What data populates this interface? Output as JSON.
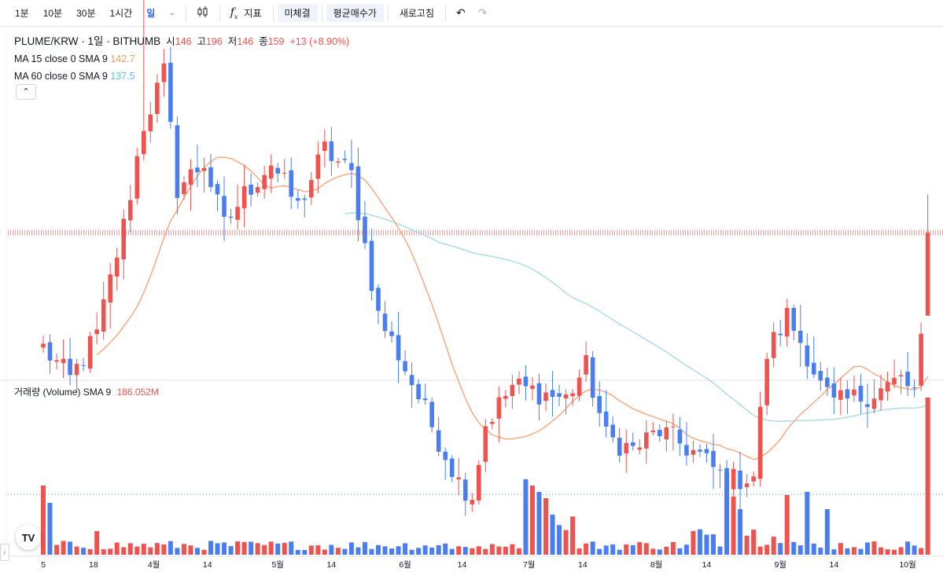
{
  "toolbar": {
    "intervals": [
      "1분",
      "10분",
      "30분",
      "1시간",
      "일"
    ],
    "active_interval": "일",
    "dropdown_icon": "chevron-down-icon",
    "chart_type_icon": "candles-icon",
    "indicators_label": "지표",
    "indicators_icon": "fx-icon",
    "unfilled_label": "미체결",
    "avg_price_label": "평균매수가",
    "refresh_label": "새로고침",
    "undo_icon": "undo-icon",
    "redo_icon": "redo-icon"
  },
  "legend": {
    "symbol": "PLUME/KRW · 1일 · BITHUMB",
    "open_label": "시",
    "open": "146",
    "high_label": "고",
    "high": "196",
    "low_label": "저",
    "low": "146",
    "close_label": "종",
    "close": "159",
    "change": "+13 (+8.90%)",
    "ma15_label": "MA 15 close 0 SMA 9",
    "ma15_value": "142.7",
    "ma60_label": "MA 60 close 0 SMA 9",
    "ma60_value": "137.5"
  },
  "volume_legend": {
    "label": "거래량 (Volume) SMA 9",
    "value": "186.052M"
  },
  "logo_text": "TV",
  "colors": {
    "up": "#ef5350",
    "down": "#4a7ef0",
    "ma15": "#f7a57a",
    "ma60": "#a6dbe6"
  },
  "chart_data": {
    "type": "candlestick",
    "x_labels": [
      "5",
      "18",
      "4월",
      "14",
      "5월",
      "14",
      "6월",
      "14",
      "7월",
      "14",
      "8월",
      "14",
      "9월",
      "14",
      "10월"
    ],
    "price_lines": {
      "upper_dotted": 196,
      "last_close": 159,
      "lower_dotted": 118
    },
    "anchors": [
      [
        0,
        141
      ],
      [
        4,
        136
      ],
      [
        8,
        143
      ],
      [
        12,
        160
      ],
      [
        15,
        176
      ],
      [
        18,
        184
      ],
      [
        20,
        166
      ],
      [
        24,
        170
      ],
      [
        27,
        160
      ],
      [
        30,
        165
      ],
      [
        34,
        170
      ],
      [
        38,
        163
      ],
      [
        42,
        172
      ],
      [
        46,
        168
      ],
      [
        50,
        146
      ],
      [
        53,
        140
      ],
      [
        57,
        131
      ],
      [
        62,
        120
      ],
      [
        64,
        118
      ],
      [
        66,
        129
      ],
      [
        70,
        135
      ],
      [
        74,
        134
      ],
      [
        78,
        133
      ],
      [
        81,
        138
      ],
      [
        84,
        127
      ],
      [
        88,
        125
      ],
      [
        92,
        128
      ],
      [
        98,
        124
      ],
      [
        102,
        120
      ],
      [
        106,
        121
      ],
      [
        108,
        140
      ],
      [
        111,
        146
      ],
      [
        114,
        140
      ],
      [
        116,
        135
      ],
      [
        118,
        132
      ],
      [
        124,
        134
      ],
      [
        128,
        136
      ],
      [
        130,
        134
      ],
      [
        132,
        149
      ]
    ],
    "first_date": "03-05",
    "last_date": "10-08",
    "volume_note": "last bar highest volume"
  }
}
